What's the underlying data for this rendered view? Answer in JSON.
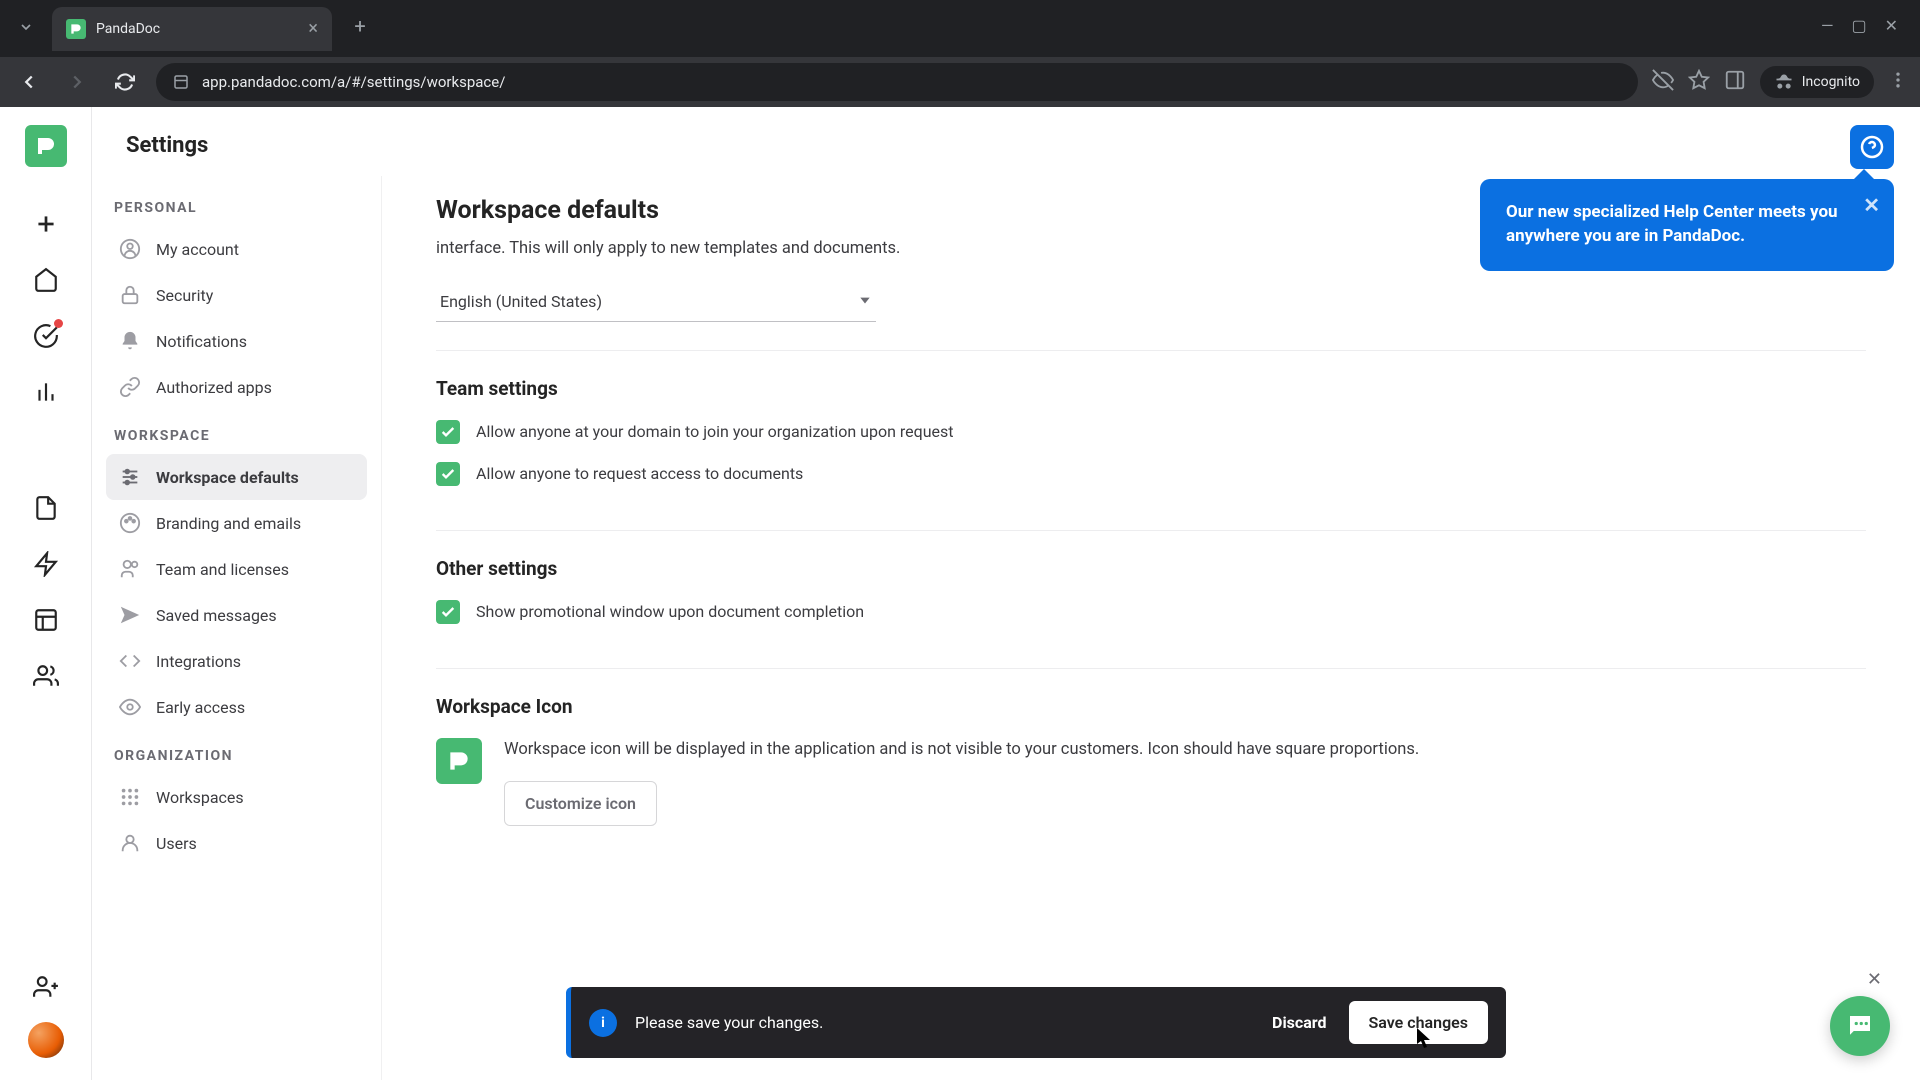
{
  "browser": {
    "tab_title": "PandaDoc",
    "url": "app.pandadoc.com/a/#/settings/workspace/",
    "incognito": "Incognito"
  },
  "header": {
    "title": "Settings"
  },
  "sidebar": {
    "personal_label": "PERSONAL",
    "workspace_label": "WORKSPACE",
    "organization_label": "ORGANIZATION",
    "personal": [
      {
        "label": "My account"
      },
      {
        "label": "Security"
      },
      {
        "label": "Notifications"
      },
      {
        "label": "Authorized apps"
      }
    ],
    "workspace": [
      {
        "label": "Workspace defaults"
      },
      {
        "label": "Branding and emails"
      },
      {
        "label": "Team and licenses"
      },
      {
        "label": "Saved messages"
      },
      {
        "label": "Integrations"
      },
      {
        "label": "Early access"
      }
    ],
    "organization": [
      {
        "label": "Workspaces"
      },
      {
        "label": "Users"
      }
    ]
  },
  "main": {
    "title": "Workspace defaults",
    "desc_line": "interface. This will only apply to new templates and documents.",
    "language": "English (United States)",
    "team_title": "Team settings",
    "team_check1": "Allow anyone at your domain to join your organization upon request",
    "team_check2": "Allow anyone to request access to documents",
    "other_title": "Other settings",
    "other_check1": "Show promotional window upon document completion",
    "icon_title": "Workspace Icon",
    "icon_desc": "Workspace icon will be displayed in the application and is not visible to your customers. Icon should have square proportions.",
    "customize_btn": "Customize icon"
  },
  "help_tip": "Our new specialized Help Center meets you anywhere you are in PandaDoc.",
  "save_bar": {
    "msg": "Please save your changes.",
    "discard": "Discard",
    "save": "Save changes"
  }
}
